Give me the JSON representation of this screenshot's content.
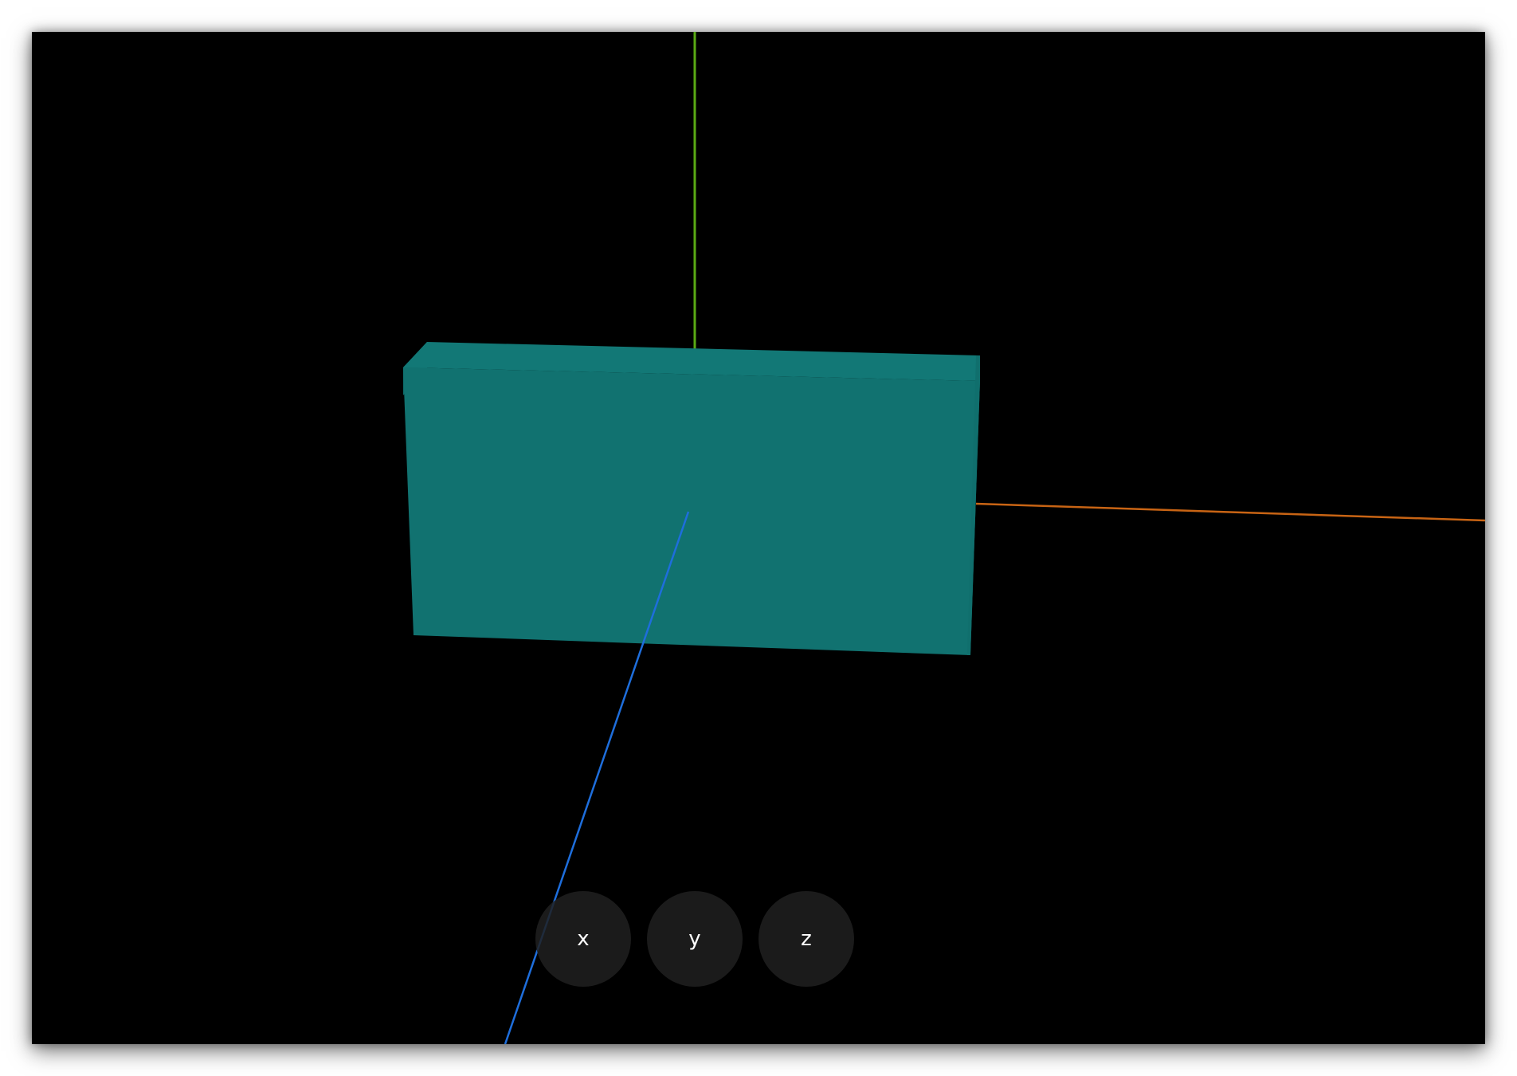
{
  "viewport": {
    "background_color": "#000000",
    "box_color_front": "#117270",
    "box_color_top": "#117776",
    "box_color_side": "#0f6e6c",
    "axis_colors": {
      "x": "#c86414",
      "y": "#5aaa14",
      "z": "#1e6edc"
    }
  },
  "controls": {
    "x_label": "x",
    "y_label": "y",
    "z_label": "z"
  }
}
